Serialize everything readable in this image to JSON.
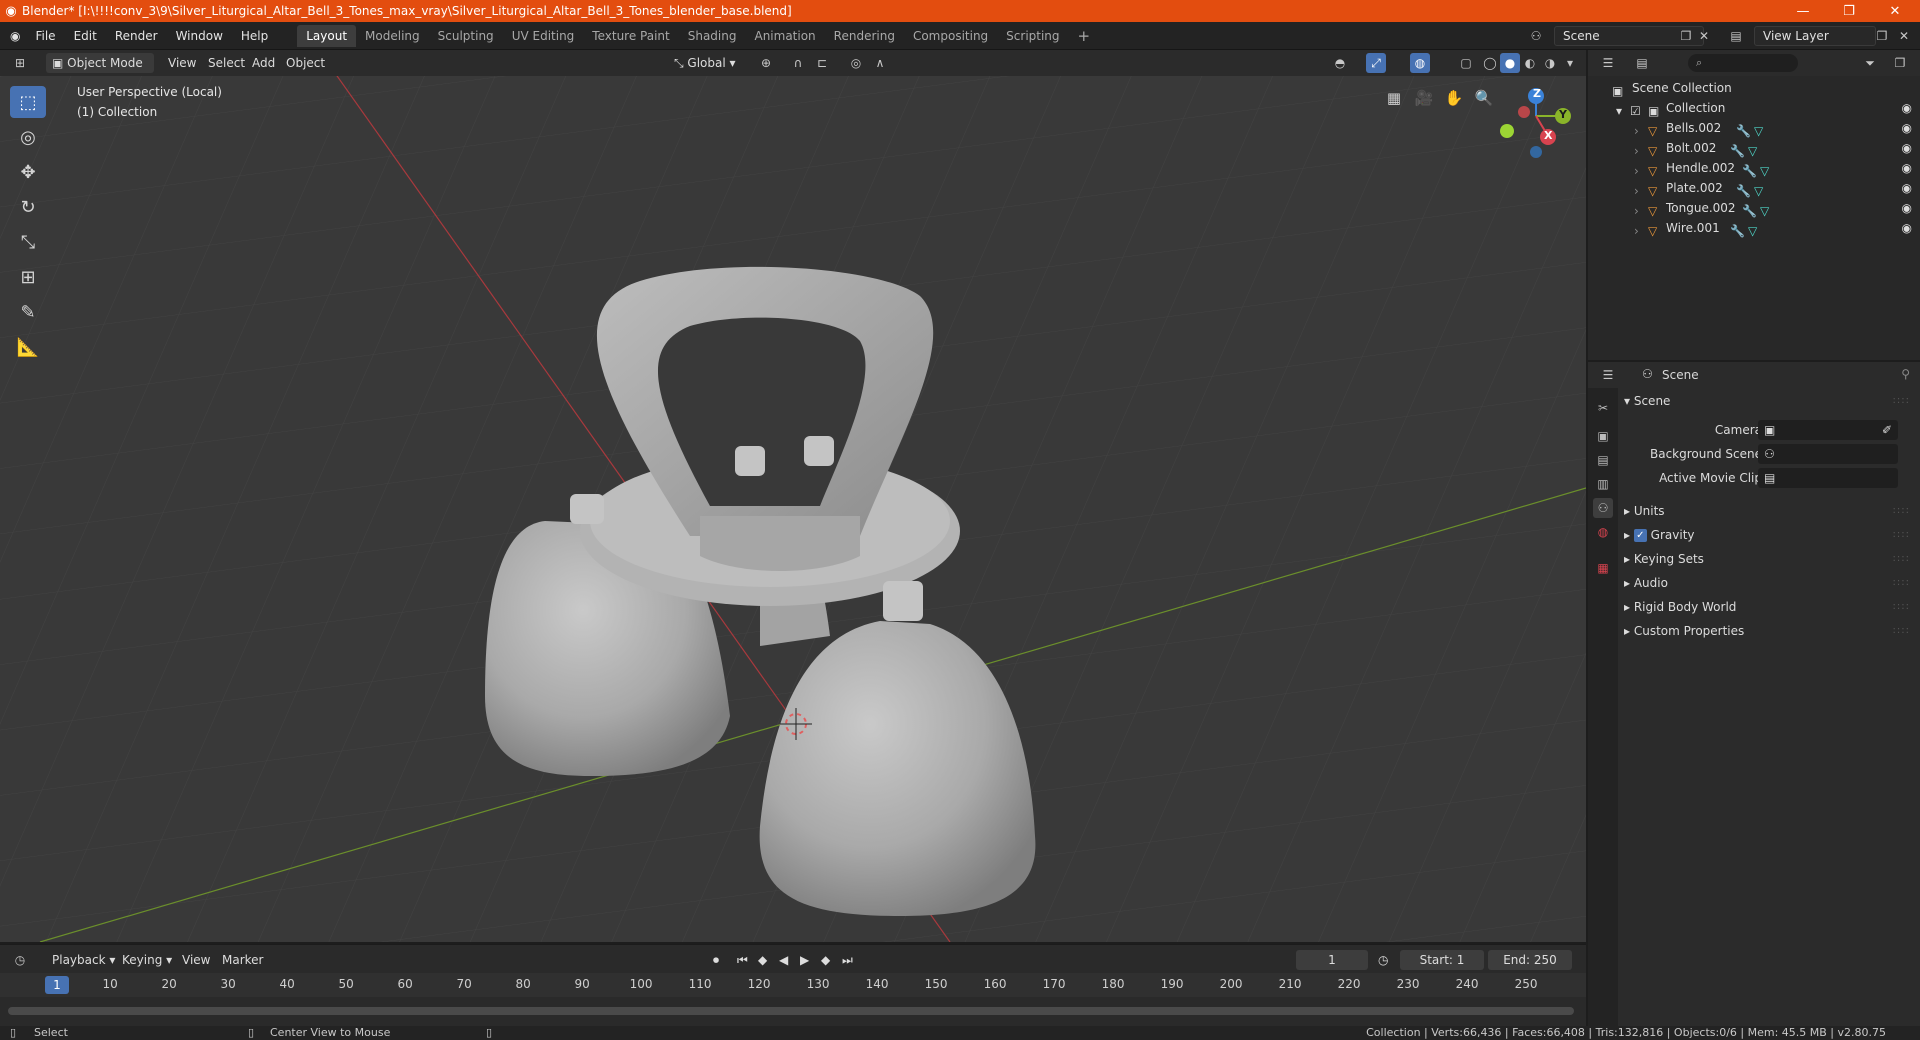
{
  "window": {
    "title": "Blender* [I:\\!!!!conv_3\\9\\Silver_Liturgical_Altar_Bell_3_Tones_max_vray\\Silver_Liturgical_Altar_Bell_3_Tones_blender_base.blend]",
    "min_icon": "minimize-icon",
    "max_icon": "maximize-icon",
    "close_icon": "close-icon"
  },
  "menus": [
    "File",
    "Edit",
    "Render",
    "Window",
    "Help"
  ],
  "workspaces": [
    "Layout",
    "Modeling",
    "Sculpting",
    "UV Editing",
    "Texture Paint",
    "Shading",
    "Animation",
    "Rendering",
    "Compositing",
    "Scripting"
  ],
  "active_workspace": "Layout",
  "scene_name": "Scene",
  "view_layer": "View Layer",
  "viewport_header": {
    "mode": "Object Mode",
    "view": "View",
    "select": "Select",
    "add": "Add",
    "object": "Object",
    "orientation": "Global"
  },
  "viewport": {
    "perspective_label": "User Perspective (Local)",
    "collection_label": "(1) Collection",
    "gizmo": {
      "z": "Z",
      "y": "Y",
      "x": "X"
    }
  },
  "outliner": {
    "root": "Scene Collection",
    "collection": "Collection",
    "items": [
      "Bells.002",
      "Bolt.002",
      "Hendle.002",
      "Plate.002",
      "Tongue.002",
      "Wire.001"
    ]
  },
  "properties": {
    "header_title": "Scene",
    "panel_title": "Scene",
    "camera_label": "Camera",
    "background_scene_label": "Background Scene",
    "active_movie_clip_label": "Active Movie Clip",
    "subpanels": [
      "Units",
      "Gravity",
      "Keying Sets",
      "Audio",
      "Rigid Body World",
      "Custom Properties"
    ],
    "gravity_checked": true
  },
  "timeline": {
    "playback": "Playback",
    "keying": "Keying",
    "view": "View",
    "marker": "Marker",
    "current_frame": "1",
    "start_label": "Start:",
    "start": "1",
    "end_label": "End:",
    "end": "250",
    "ticks": [
      "10",
      "20",
      "30",
      "40",
      "50",
      "60",
      "70",
      "80",
      "90",
      "100",
      "110",
      "120",
      "130",
      "140",
      "150",
      "160",
      "170",
      "180",
      "190",
      "200",
      "210",
      "220",
      "230",
      "240",
      "250"
    ]
  },
  "statusbar": {
    "select": "Select",
    "center_view": "Center View to Mouse",
    "stats": "Collection | Verts:66,436 | Faces:66,408 | Tris:132,816 | Objects:0/6 | Mem: 45.5 MB | v2.80.75"
  }
}
